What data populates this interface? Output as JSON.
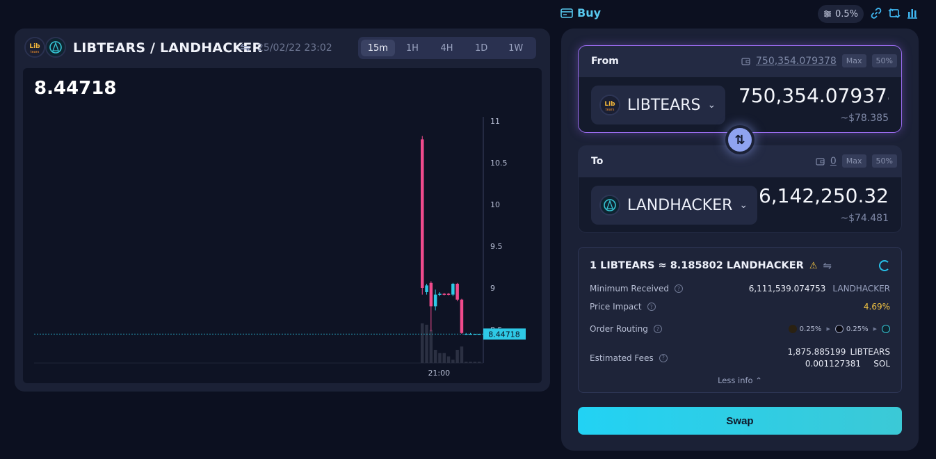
{
  "header": {
    "buy_label": "Buy",
    "slippage": "0.5%"
  },
  "chart_panel": {
    "pair": "LIBTEARS / LANDHACKER",
    "date": "25/02/22 23:02",
    "timeframes": [
      "15m",
      "1H",
      "4H",
      "1D",
      "1W"
    ],
    "active_timeframe": "15m",
    "last_price": "8.44718"
  },
  "chart_data": {
    "type": "candlestick",
    "title": "",
    "y_ticks": [
      "11",
      "10.5",
      "10",
      "9.5",
      "9",
      "8.5"
    ],
    "ylim": [
      8.1,
      11.05
    ],
    "x_ticks": [
      "21:00"
    ],
    "current_price": 8.44718,
    "current_price_label": "8.44718",
    "candles": [
      {
        "open": 9.0,
        "high": 10.82,
        "low": 8.92,
        "close": 10.78,
        "dir": "down"
      },
      {
        "open": 8.95,
        "high": 9.05,
        "low": 8.92,
        "close": 9.03,
        "dir": "up"
      },
      {
        "open": 9.06,
        "high": 9.08,
        "low": 8.48,
        "close": 8.78,
        "dir": "down"
      },
      {
        "open": 8.78,
        "high": 8.98,
        "low": 8.73,
        "close": 8.92,
        "dir": "up"
      },
      {
        "open": 8.92,
        "high": 8.95,
        "low": 8.9,
        "close": 8.93,
        "dir": "up"
      },
      {
        "open": 8.93,
        "high": 8.94,
        "low": 8.91,
        "close": 8.92,
        "dir": "down"
      },
      {
        "open": 8.92,
        "high": 8.94,
        "low": 8.91,
        "close": 8.93,
        "dir": "down"
      },
      {
        "open": 8.92,
        "high": 9.06,
        "low": 8.9,
        "close": 9.05,
        "dir": "up"
      },
      {
        "open": 9.05,
        "high": 9.06,
        "low": 8.84,
        "close": 8.86,
        "dir": "down"
      },
      {
        "open": 8.86,
        "high": 8.87,
        "low": 8.45,
        "close": 8.46,
        "dir": "down"
      },
      {
        "open": 8.45,
        "high": 8.46,
        "low": 8.44,
        "close": 8.45,
        "dir": "flat"
      },
      {
        "open": 8.45,
        "high": 8.46,
        "low": 8.44,
        "close": 8.45,
        "dir": "flat"
      },
      {
        "open": 8.45,
        "high": 8.45,
        "low": 8.44,
        "close": 8.45,
        "dir": "flat"
      },
      {
        "open": 8.45,
        "high": 8.45,
        "low": 8.44,
        "close": 8.45,
        "dir": "flat"
      }
    ],
    "volumes": [
      0.6,
      0.58,
      0.5,
      0.2,
      0.15,
      0.15,
      0.1,
      0.05,
      0.2,
      0.25,
      0.02,
      0.02,
      0.02,
      0.02
    ],
    "colors": {
      "up": "#2ec9e6",
      "down": "#f04b8c",
      "volume": "#2b3042",
      "price_line": "#2ec9e6"
    }
  },
  "from": {
    "label": "From",
    "balance": "750,354.079378",
    "max_label": "Max",
    "half_label": "50%",
    "token": "LIBTEARS",
    "amount": "750,354.079378",
    "usd": "~$78.385"
  },
  "to": {
    "label": "To",
    "balance": "0",
    "max_label": "Max",
    "half_label": "50%",
    "token": "LANDHACKER",
    "amount": "6,142,250.32",
    "usd": "~$74.481"
  },
  "info": {
    "rate": "1 LIBTEARS ≈ 8.185802 LANDHACKER",
    "min_received_label": "Minimum Received",
    "min_received_value": "6,111,539.074753",
    "min_received_unit": "LANDHACKER",
    "price_impact_label": "Price Impact",
    "price_impact_value": "4.69%",
    "order_routing_label": "Order Routing",
    "route_fee_1": "0.25%",
    "route_fee_2": "0.25%",
    "fees_label": "Estimated Fees",
    "fee_1_value": "1,875.885199",
    "fee_1_unit": "LIBTEARS",
    "fee_2_value": "0.001127381",
    "fee_2_unit": "SOL",
    "less_info": "Less info"
  },
  "swap_button": "Swap",
  "colors": {
    "accent": "#22d2f4",
    "from_border": "#9b6cf0",
    "impact": "#f4c542",
    "panel": "#1b2136",
    "background": "#0c1020"
  }
}
